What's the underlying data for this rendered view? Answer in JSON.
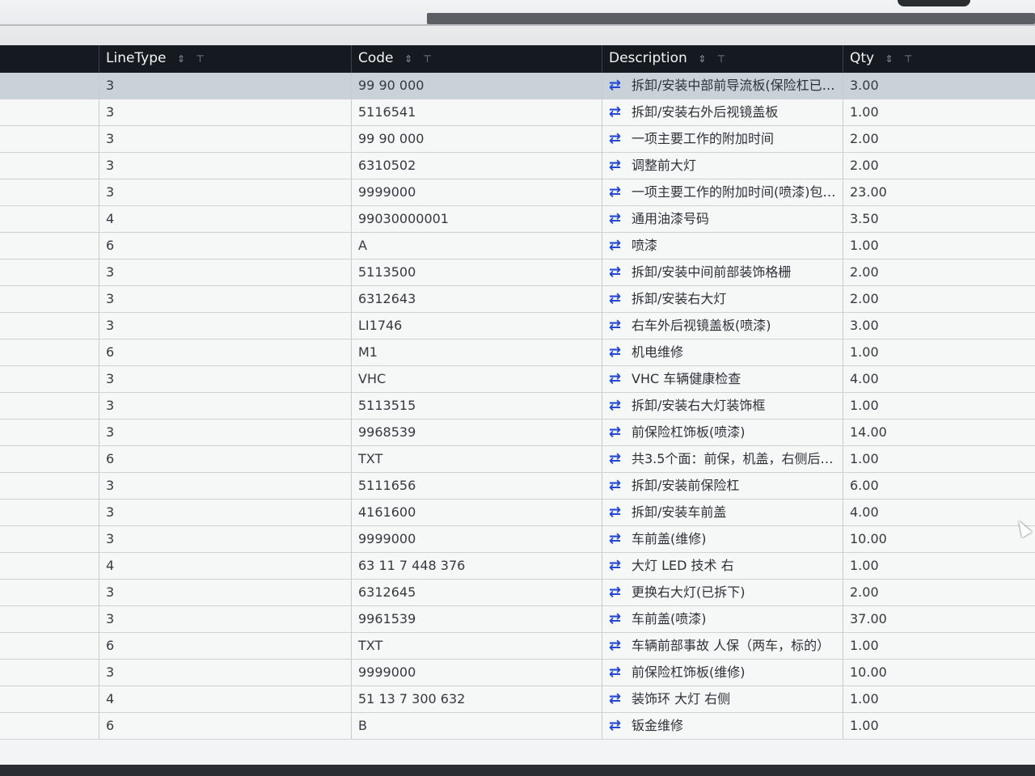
{
  "columns": {
    "line_type": "LineType",
    "code": "Code",
    "description": "Description",
    "qty": "Qty",
    "sort_glyph": "⇕",
    "filter_glyph": "⊤"
  },
  "rows": [
    {
      "line_type": "3",
      "code": "99 90 000",
      "description": "拆卸/安装中部前导流板(保险杠已…",
      "qty": "3.00"
    },
    {
      "line_type": "3",
      "code": "5116541",
      "description": "拆卸/安装右外后视镜盖板",
      "qty": "1.00"
    },
    {
      "line_type": "3",
      "code": "99 90 000",
      "description": "一项主要工作的附加时间",
      "qty": "2.00"
    },
    {
      "line_type": "3",
      "code": "6310502",
      "description": "调整前大灯",
      "qty": "2.00"
    },
    {
      "line_type": "3",
      "code": "9999000",
      "description": "一项主要工作的附加时间(喷漆)包…",
      "qty": "23.00"
    },
    {
      "line_type": "4",
      "code": "99030000001",
      "description": "通用油漆号码",
      "qty": "3.50"
    },
    {
      "line_type": "6",
      "code": "A",
      "description": "喷漆",
      "qty": "1.00"
    },
    {
      "line_type": "3",
      "code": "5113500",
      "description": "拆卸/安装中间前部装饰格栅",
      "qty": "2.00"
    },
    {
      "line_type": "3",
      "code": "6312643",
      "description": "拆卸/安装右大灯",
      "qty": "2.00"
    },
    {
      "line_type": "3",
      "code": "LI1746",
      "description": "右车外后视镜盖板(喷漆)",
      "qty": "3.00"
    },
    {
      "line_type": "6",
      "code": "M1",
      "description": "机电维修",
      "qty": "1.00"
    },
    {
      "line_type": "3",
      "code": "VHC",
      "description": "VHC 车辆健康检查",
      "qty": "4.00"
    },
    {
      "line_type": "3",
      "code": "5113515",
      "description": "拆卸/安装右大灯装饰框",
      "qty": "1.00"
    },
    {
      "line_type": "3",
      "code": "9968539",
      "description": "前保险杠饰板(喷漆)",
      "qty": "14.00"
    },
    {
      "line_type": "6",
      "code": "TXT",
      "description": "共3.5个面：前保，机盖，右侧后…",
      "qty": "1.00"
    },
    {
      "line_type": "3",
      "code": "5111656",
      "description": "拆卸/安装前保险杠",
      "qty": "6.00"
    },
    {
      "line_type": "3",
      "code": "4161600",
      "description": "拆卸/安装车前盖",
      "qty": "4.00"
    },
    {
      "line_type": "3",
      "code": "9999000",
      "description": "车前盖(维修)",
      "qty": "10.00"
    },
    {
      "line_type": "4",
      "code": "63 11 7 448 376",
      "description": "大灯 LED 技术 右",
      "qty": "1.00"
    },
    {
      "line_type": "3",
      "code": "6312645",
      "description": "更换右大灯(已拆下)",
      "qty": "2.00"
    },
    {
      "line_type": "3",
      "code": "9961539",
      "description": "车前盖(喷漆)",
      "qty": "37.00"
    },
    {
      "line_type": "6",
      "code": "TXT",
      "description": "车辆前部事故 人保（两车，标的）",
      "qty": "1.00"
    },
    {
      "line_type": "3",
      "code": "9999000",
      "description": "前保险杠饰板(维修)",
      "qty": "10.00"
    },
    {
      "line_type": "4",
      "code": "51 13 7 300 632",
      "description": "装饰环 大灯 右侧",
      "qty": "1.00"
    },
    {
      "line_type": "6",
      "code": "B",
      "description": "钣金维修",
      "qty": "1.00"
    }
  ],
  "selected_row_index": 0,
  "swap_icon_glyph": "⇄",
  "colors": {
    "header_bg": "#151a20",
    "selected_row": "#c9d2d6",
    "swap_icon": "#1f47d8"
  }
}
